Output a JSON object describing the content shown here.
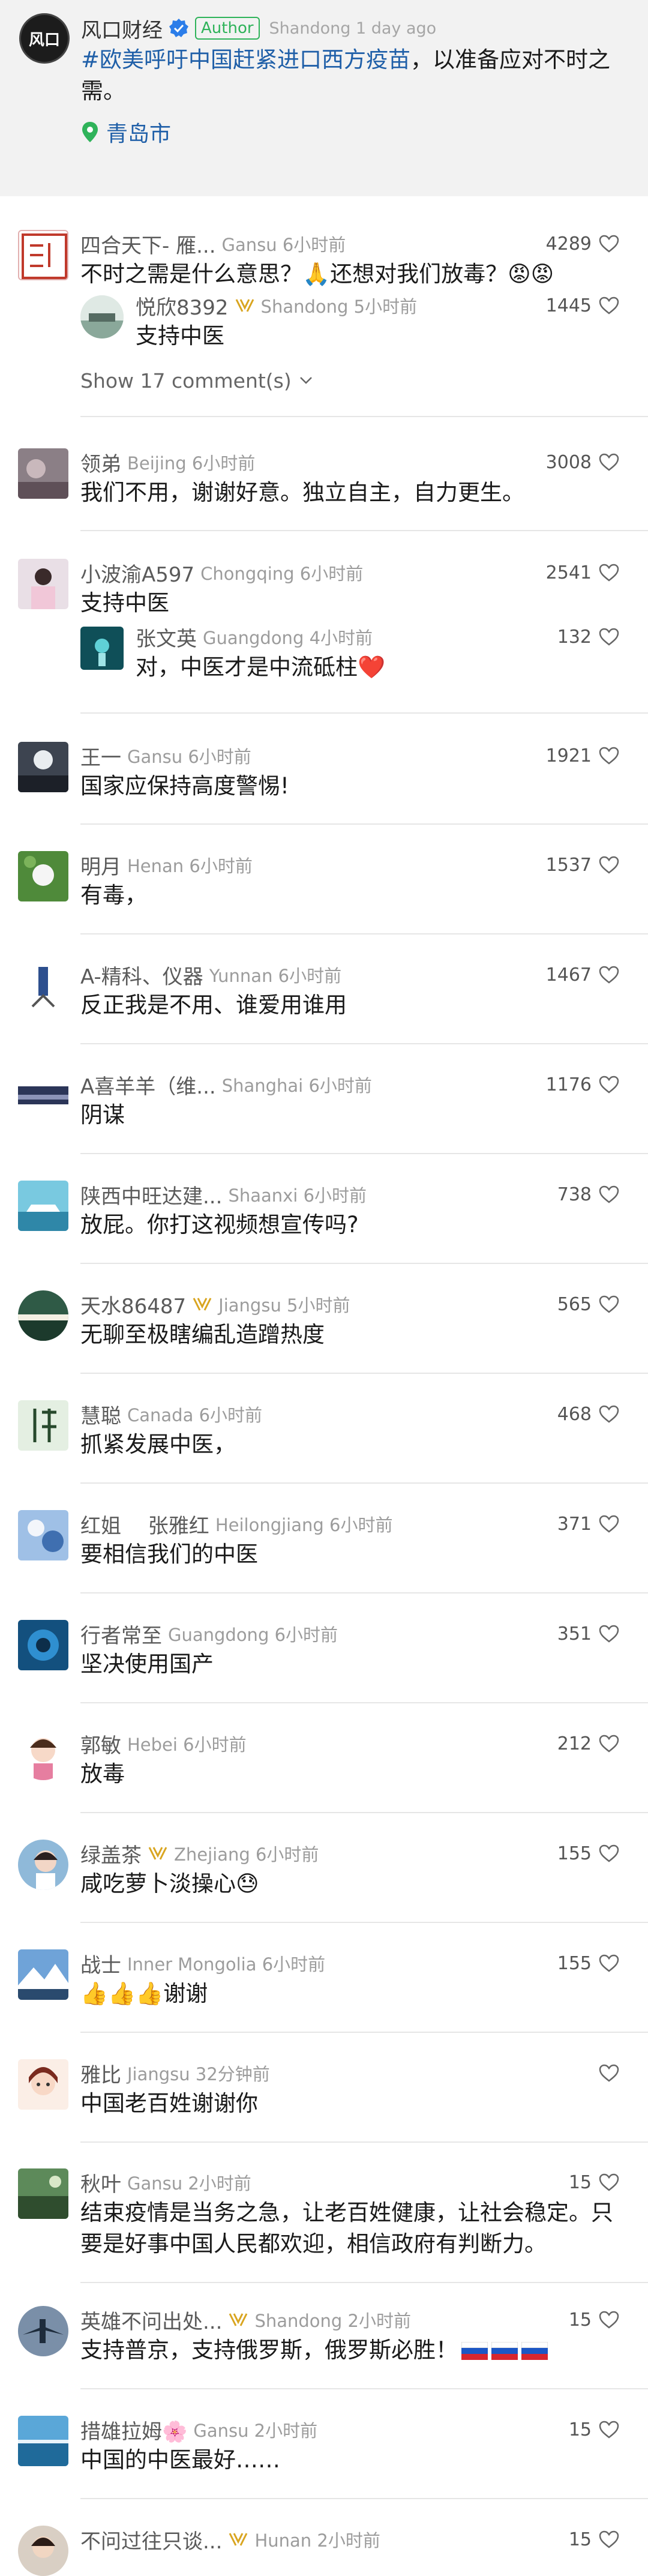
{
  "post": {
    "author": "风口财经",
    "avatar_text": "风口",
    "author_badge": "Author",
    "meta": "Shandong 1 day ago",
    "hashtag": "#欧美呼吁中国赶紧进口西方疫苗",
    "text": "，以准备应对不时之需。",
    "location": "青岛市"
  },
  "comments": [
    {
      "name": "四合天下- 雁...",
      "region": "Gansu 6小时前",
      "likes": "4289",
      "text": "不时之需是什么意思？🙏还想对我们放毒？😡😡"
    },
    {
      "reply": true,
      "name": "悦欣8392",
      "badge": true,
      "region": "Shandong 5小时前",
      "likes": "1445",
      "text": "支持中医"
    },
    {
      "name": "领弟",
      "region": "Beijing 6小时前",
      "likes": "3008",
      "text": "我们不用，谢谢好意。独立自主，自力更生。"
    },
    {
      "name": "小波渝A597",
      "region": "Chongqing 6小时前",
      "likes": "2541",
      "text": "支持中医"
    },
    {
      "reply": true,
      "name": "张文英",
      "region": "Guangdong 4小时前",
      "likes": "132",
      "text": "对，中医才是中流砥柱❤️"
    },
    {
      "name": "王一",
      "region": "Gansu 6小时前",
      "likes": "1921",
      "text": "国家应保持高度警惕!"
    },
    {
      "name": "明月",
      "region": "Henan 6小时前",
      "likes": "1537",
      "text": "有毒，"
    },
    {
      "name": "A-精科、仪器",
      "region": "Yunnan 6小时前",
      "likes": "1467",
      "text": "反正我是不用、谁爱用谁用"
    },
    {
      "name": "A喜羊羊（维...",
      "region": "Shanghai 6小时前",
      "likes": "1176",
      "text": "阴谋"
    },
    {
      "name": "陕西中旺达建...",
      "region": "Shaanxi 6小时前",
      "likes": "738",
      "text": "放屁。你打这视频想宣传吗?"
    },
    {
      "name": "天水86487",
      "badge": true,
      "region": "Jiangsu 5小时前",
      "likes": "565",
      "text": "无聊至极瞎编乱造蹭热度"
    },
    {
      "name": "慧聪",
      "region": "Canada 6小时前",
      "likes": "468",
      "text": "抓紧发展中医，"
    },
    {
      "name": "红姐　 张雅红",
      "region": "Heilongjiang 6小时前",
      "likes": "371",
      "text": "要相信我们的中医"
    },
    {
      "name": "行者常至",
      "region": "Guangdong 6小时前",
      "likes": "351",
      "text": "坚决使用国产"
    },
    {
      "name": "郭敏",
      "region": "Hebei 6小时前",
      "likes": "212",
      "text": "放毒"
    },
    {
      "name": "绿盖茶",
      "badge": true,
      "region": "Zhejiang 6小时前",
      "likes": "155",
      "text": "咸吃萝卜淡操心😓"
    },
    {
      "name": "战士",
      "region": "Inner Mongolia 6小时前",
      "likes": "155",
      "text": "👍👍👍谢谢"
    },
    {
      "name": "雅比",
      "region": "Jiangsu 32分钟前",
      "likes": "",
      "text": "中国老百姓谢谢你"
    },
    {
      "name": "秋叶",
      "region": "Gansu 2小时前",
      "likes": "15",
      "text": "结束疫情是当务之急，让老百姓健康，让社会稳定。只要是好事中国人民都欢迎，相信政府有判断力。"
    },
    {
      "name": "英雄不问出处...",
      "badge": true,
      "region": "Shandong 2小时前",
      "likes": "15",
      "text": "支持普京，支持俄罗斯，俄罗斯必胜！"
    },
    {
      "name": "措雄拉姆🌸",
      "region": "Gansu 2小时前",
      "likes": "15",
      "text": "中国的中医最好……"
    },
    {
      "name": "不问过往只谈...",
      "badge": true,
      "region": "Hunan 2小时前",
      "likes": "15",
      "text": ""
    }
  ],
  "show_more": "Show 17 comment(s)",
  "colors": {
    "link": "#1f5fa8",
    "author_green": "#2fb35a",
    "muted": "#9c9c9c"
  }
}
